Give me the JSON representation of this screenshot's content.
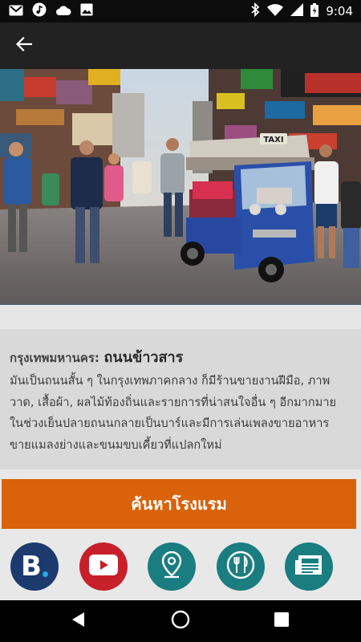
{
  "status_bar": {
    "time": "9:04",
    "left_icons": [
      "gmail-icon",
      "music-note-icon",
      "cloud-icon",
      "image-icon"
    ],
    "right_icons": [
      "bluetooth-icon",
      "wifi-icon",
      "signal-icon",
      "battery-icon"
    ]
  },
  "app_bar": {
    "back_icon": "arrow-left-icon"
  },
  "hero": {
    "taxi_sign": "TAXI"
  },
  "info": {
    "city": "กรุงเทพมหานคร:",
    "place": "ถนนข้าวสาร",
    "description_lines": [
      "มันเป็นถนนสั้น ๆ ในกรุงเทพภาคกลาง ก็มีร้านขายงานฝีมือ, ภาพ",
      "วาด, เสื้อผ้า, ผลไม้ท้องถิ่นและรายการที่น่าสนใจอื่น ๆ อีกมากมาย",
      "ในช่วงเย็นปลายถนนกลายเป็นบาร์และมีการเล่นเพลงขายอาหาร",
      "ขายแมลงย่างและขนมขบเคี้ยวที่แปลกใหม่"
    ]
  },
  "search_button": {
    "label": "ค้นหาโรงแรม",
    "color": "#d9620b"
  },
  "action_icons": [
    {
      "name": "booking-icon",
      "letter": "B",
      "color": "#1c3a6e"
    },
    {
      "name": "youtube-icon",
      "color": "#c7202a"
    },
    {
      "name": "map-pin-icon",
      "color": "#1a7d80"
    },
    {
      "name": "restaurant-icon",
      "color": "#1a7d80"
    },
    {
      "name": "newspaper-icon",
      "color": "#1a7d80"
    }
  ],
  "nav_bar": {
    "icons": [
      "nav-back-icon",
      "nav-home-icon",
      "nav-recents-icon"
    ]
  }
}
